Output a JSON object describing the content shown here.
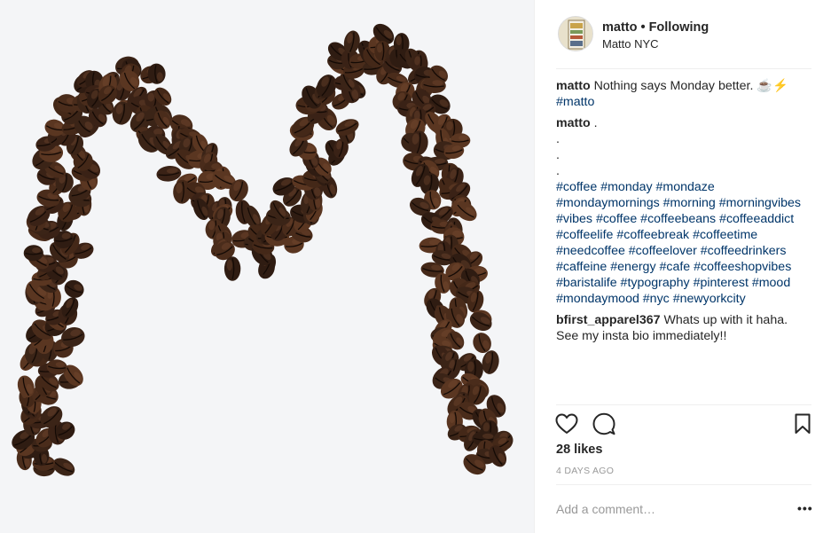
{
  "header": {
    "username": "matto",
    "separator": "•",
    "follow_status": "Following",
    "location": "Matto NYC"
  },
  "caption": {
    "username": "matto",
    "text": "Nothing says Monday better. ☕⚡",
    "hashtag": "#matto"
  },
  "comment1": {
    "username": "matto",
    "text": ".",
    "dots": [
      ".",
      ".",
      "."
    ],
    "hashtags": [
      "#coffee #monday #mondaze",
      "#mondaymornings #morning #morningvibes",
      "#vibes #coffee #coffeebeans #coffeeaddict",
      "#coffeelife #coffeebreak #coffeetime",
      "#needcoffee #coffeelover #coffeedrinkers",
      "#caffeine #energy #cafe #coffeeshopvibes",
      "#baristalife #typography #pinterest #mood",
      "#mondaymood #nyc #newyorkcity"
    ]
  },
  "comment2": {
    "username": "bfirst_apparel367",
    "text": "Whats up with it haha. See my insta bio immediately!!"
  },
  "likes": "28 likes",
  "time": "4 DAYS AGO",
  "add_comment_placeholder": "Add a comment…",
  "more_label": "•••",
  "icons": [
    "heart-icon",
    "comment-icon",
    "bookmark-icon"
  ]
}
